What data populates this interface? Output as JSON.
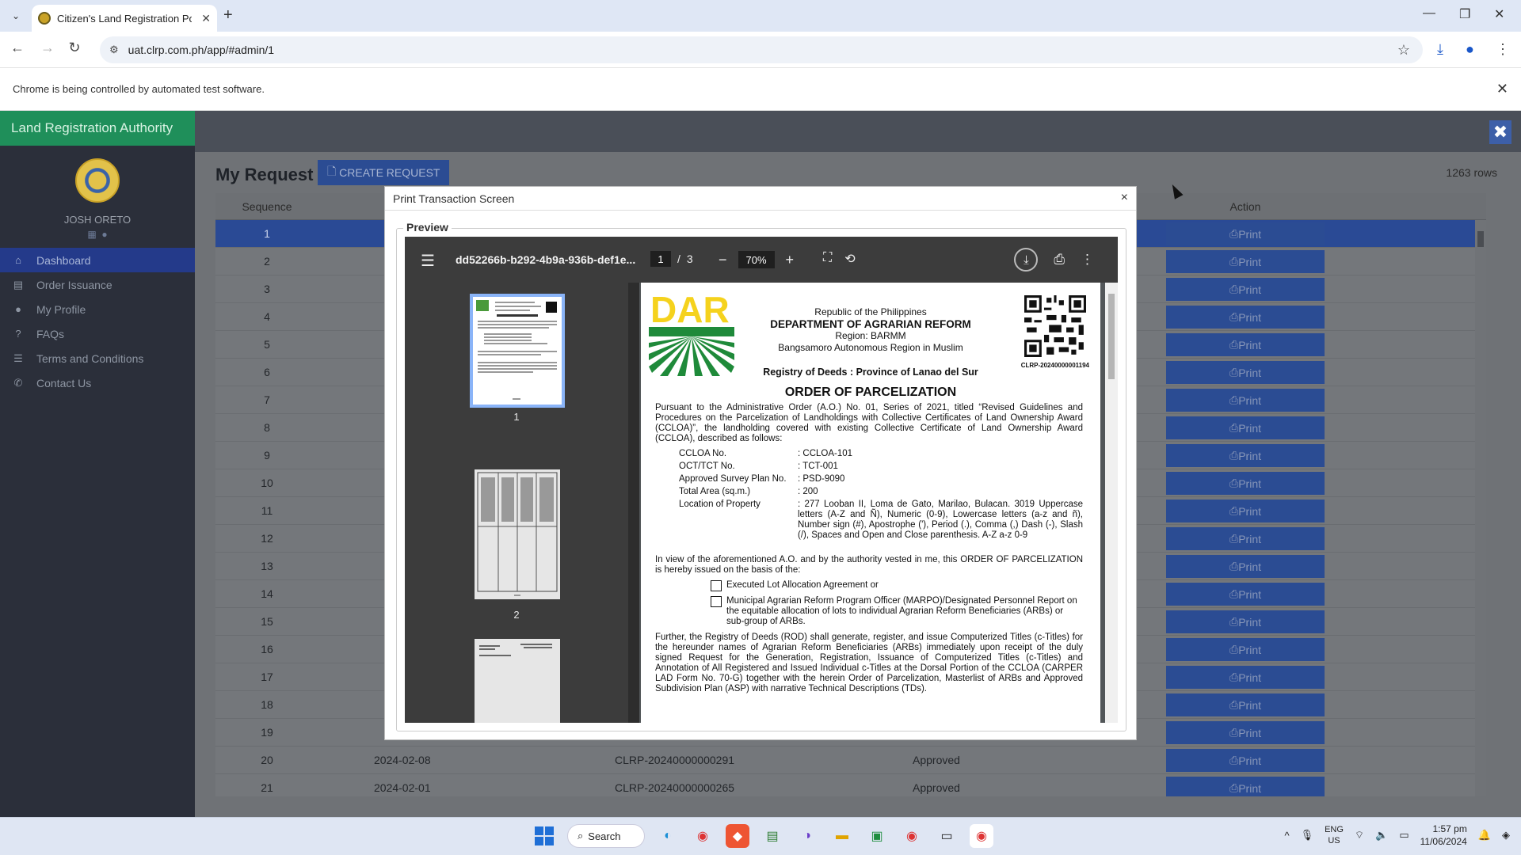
{
  "browser": {
    "tab_title": "Citizen's Land Registration Port",
    "url": "uat.clrp.com.ph/app/#admin/1",
    "infobar": "Chrome is being controlled by automated test software."
  },
  "app": {
    "brand": "Land Registration Authority",
    "user_name": "JOSH ORETO",
    "menu": [
      {
        "label": "Dashboard",
        "icon": "home-icon"
      },
      {
        "label": "Order Issuance",
        "icon": "file-icon"
      },
      {
        "label": "My Profile",
        "icon": "user-icon"
      },
      {
        "label": "FAQs",
        "icon": "question-icon"
      },
      {
        "label": "Terms and Conditions",
        "icon": "list-icon"
      },
      {
        "label": "Contact Us",
        "icon": "phone-icon"
      }
    ],
    "page_title": "My Request",
    "create_label": "CREATE REQUEST",
    "rows_count": "1263 rows",
    "table": {
      "col_sequence": "Sequence",
      "col_action": "Action",
      "print_label": "Print",
      "rows": [
        {
          "seq": "1",
          "date": "",
          "ref": "",
          "status": ""
        },
        {
          "seq": "2",
          "date": "",
          "ref": "",
          "status": ""
        },
        {
          "seq": "3",
          "date": "",
          "ref": "",
          "status": ""
        },
        {
          "seq": "4",
          "date": "",
          "ref": "",
          "status": ""
        },
        {
          "seq": "5",
          "date": "",
          "ref": "",
          "status": ""
        },
        {
          "seq": "6",
          "date": "",
          "ref": "",
          "status": ""
        },
        {
          "seq": "7",
          "date": "",
          "ref": "",
          "status": ""
        },
        {
          "seq": "8",
          "date": "",
          "ref": "",
          "status": ""
        },
        {
          "seq": "9",
          "date": "",
          "ref": "",
          "status": ""
        },
        {
          "seq": "10",
          "date": "",
          "ref": "",
          "status": ""
        },
        {
          "seq": "11",
          "date": "",
          "ref": "",
          "status": ""
        },
        {
          "seq": "12",
          "date": "",
          "ref": "",
          "status": ""
        },
        {
          "seq": "13",
          "date": "",
          "ref": "",
          "status": ""
        },
        {
          "seq": "14",
          "date": "",
          "ref": "",
          "status": ""
        },
        {
          "seq": "15",
          "date": "",
          "ref": "",
          "status": ""
        },
        {
          "seq": "16",
          "date": "",
          "ref": "",
          "status": ""
        },
        {
          "seq": "17",
          "date": "",
          "ref": "",
          "status": ""
        },
        {
          "seq": "18",
          "date": "",
          "ref": "",
          "status": ""
        },
        {
          "seq": "19",
          "date": "",
          "ref": "",
          "status": ""
        },
        {
          "seq": "20",
          "date": "2024-02-08",
          "ref": "CLRP-20240000000291",
          "status": "Approved"
        },
        {
          "seq": "21",
          "date": "2024-02-01",
          "ref": "CLRP-20240000000265",
          "status": "Approved"
        }
      ]
    }
  },
  "modal": {
    "title": "Print Transaction Screen",
    "legend": "Preview",
    "viewer": {
      "file_name": "dd52266b-b292-4b9a-936b-def1e...",
      "page_current": "1",
      "page_sep": "/",
      "page_total": "3",
      "zoom": "70%",
      "thumb_labels": [
        "1",
        "2"
      ]
    },
    "doc": {
      "republic": "Republic of the Philippines",
      "department": "DEPARTMENT OF AGRARIAN REFORM",
      "region": "Region:  BARMM",
      "region_full": "Bangsamoro Autonomous Region in Muslim",
      "rod": "Registry of Deeds  :  Province of Lanao del Sur",
      "qr_label": "CLRP-20240000001194",
      "order_title": "ORDER OF PARCELIZATION",
      "intro": "Pursuant to the Administrative Order (A.O.) No. 01, Series of 2021, titled “Revised Guidelines and Procedures on the Parcelization of Landholdings with Collective Certificates of Land Ownership Award (CCLOA)”, the landholding covered with existing Collective Certificate of Land Ownership Award (CCLOA), described as follows:",
      "fields": [
        {
          "k": "CCLOA No.",
          "v": ": CCLOA-101"
        },
        {
          "k": "OCT/TCT No.",
          "v": ": TCT-001"
        },
        {
          "k": "Approved Survey Plan No.",
          "v": ": PSD-9090"
        },
        {
          "k": "Total Area (sq.m.)",
          "v": ": 200"
        },
        {
          "k": "Location of Property",
          "v": ": 277 Looban II, Loma de Gato, Marilao, Bulacan. 3019 Uppercase letters (A-Z and Ñ), Numeric (0-9), Lowercase letters (a-z and ñ), Number sign (#), Apostrophe ('), Period (.), Comma (,) Dash (-), Slash (/), Spaces and Open and Close parenthesis. A-Z a-z 0-9"
        }
      ],
      "view": "In view of the aforementioned A.O. and by the authority vested in me, this ORDER OF PARCELIZATION is hereby issued on the basis of the:",
      "check1": "Executed Lot Allocation Agreement or",
      "check2": "Municipal Agrarian Reform Program Officer (MARPO)/Designated Personnel Report on the equitable allocation of lots to individual Agrarian Reform Beneficiaries (ARBs) or sub-group of ARBs.",
      "further": "Further, the Registry of Deeds (ROD) shall generate, register, and issue Computerized Titles (c-Titles) for the hereunder names of Agrarian Reform Beneficiaries (ARBs) immediately upon receipt of the duly signed Request for the Generation, Registration, Issuance of Computerized Titles (c-Titles) and Annotation of All Registered and Issued Individual c-Titles at the Dorsal Portion of the CCLOA (CARPER LAD Form No. 70-G) together with the herein Order of Parcelization, Masterlist of ARBs and Approved Subdivision Plan (ASP) with narrative Technical Descriptions (TDs)."
    }
  },
  "taskbar": {
    "search": "Search",
    "lang1": "ENG",
    "lang2": "US",
    "time": "1:57 pm",
    "date": "11/06/2024"
  },
  "colors": {
    "brand_green": "#1f8f5a",
    "primary_blue": "#2b4c93",
    "sidebar": "#2b2f3a"
  }
}
